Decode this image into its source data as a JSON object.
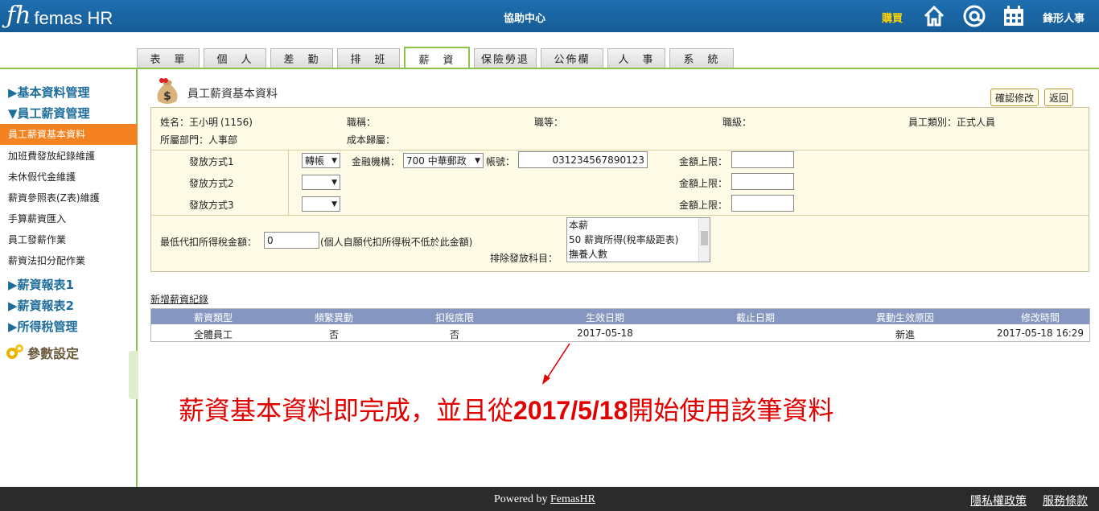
{
  "header": {
    "logo_mark": "ƒh",
    "logo_text": "femas HR",
    "center_title": "協助中心",
    "buy_label": "購買",
    "user_name": "鋒形人事",
    "colors": {
      "bar": "#1a66a6",
      "buy": "#ffd200"
    }
  },
  "tabs": [
    {
      "label": "表　單"
    },
    {
      "label": "個　人"
    },
    {
      "label": "差　勤"
    },
    {
      "label": "排　班"
    },
    {
      "label": "薪　資",
      "active": true
    },
    {
      "label": "保險勞退"
    },
    {
      "label": "公佈欄"
    },
    {
      "label": "人　事"
    },
    {
      "label": "系　統"
    }
  ],
  "sidebar": {
    "groups": {
      "basic": "▶基本資料管理",
      "salary": "▼員工薪資管理",
      "report1": "▶薪資報表1",
      "report2": "▶薪資報表2",
      "tax": "▶所得稅管理"
    },
    "items": [
      "員工薪資基本資料",
      "加班費發放紀錄維護",
      "未休假代金維護",
      "薪資參照表(Z表)維護",
      "手算薪資匯入",
      "員工發薪作業",
      "薪資法扣分配作業"
    ],
    "param_label": "參數設定"
  },
  "page": {
    "title": "員工薪資基本資料",
    "confirm_btn": "確認修改",
    "back_btn": "返回"
  },
  "form": {
    "name_label": "姓名：",
    "name_value": "王小明",
    "emp_no": "(1156)",
    "job_title_label": "職稱：",
    "grade_label": "職等：",
    "level_label": "職級：",
    "emp_type_label": "員工類別：",
    "emp_type_value": "正式人員",
    "dept_label": "所屬部門：",
    "dept_value": "人事部",
    "cost_label": "成本歸屬：",
    "pay_method_1": "發放方式1",
    "pay_method_2": "發放方式2",
    "pay_method_3": "發放方式3",
    "pay_select_1": "轉帳",
    "bank_label": "金融機構：",
    "bank_value": "700 中華郵政",
    "account_label": "帳號：",
    "account_value": "031234567890123",
    "limit_label": "金額上限：",
    "min_tax_label": "最低代扣所得稅金額：",
    "min_tax_value": "0",
    "min_tax_note": "(個人自願代扣所得稅不低於此金額)",
    "exclude_label": "排除發放科目：",
    "exclude_options": [
      "本薪",
      "50 薪資所得(稅率級距表)",
      "撫養人數"
    ]
  },
  "records": {
    "add_link": "新增薪資紀錄",
    "columns": [
      "薪資類型",
      "頻繁異動",
      "扣稅底限",
      "生效日期",
      "截止日期",
      "異動生效原因",
      "修改時間"
    ],
    "rows": [
      [
        "全體員工",
        "否",
        "否",
        "2017-05-18",
        "",
        "新進",
        "2017-05-18 16:29"
      ]
    ],
    "header_color": "#8597c0"
  },
  "annotation": {
    "text_before": "薪資基本資料即完成，並且從",
    "date": "2017/5/18",
    "text_after": "開始使用該筆資料",
    "color": "#e00000"
  },
  "footer": {
    "powered_by": "Powered by",
    "brand": "FemasHR",
    "privacy": "隱私權政策",
    "terms": "服務條款"
  }
}
